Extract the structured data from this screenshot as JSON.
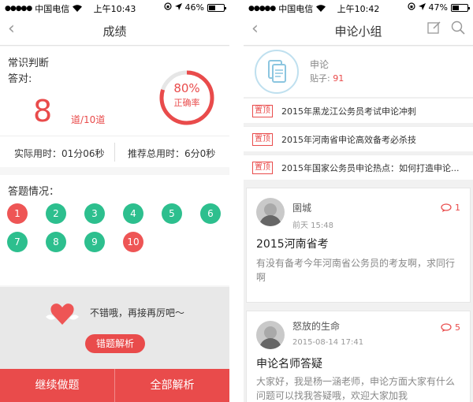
{
  "left": {
    "status": {
      "carrier": "中国电信",
      "time": "上午10:43",
      "battery": "46%",
      "battery_level": 0.46
    },
    "nav_title": "成绩",
    "category": "常识判断",
    "correct_label": "答对:",
    "correct_count": "8",
    "total_label": "道/10道",
    "accuracy": "80%",
    "accuracy_label": "正确率",
    "accuracy_fraction": 0.8,
    "actual_time": "实际用时：01分06秒",
    "recommended_time": "推荐总用时：6分0秒",
    "answers_label": "答题情况：",
    "answers": [
      {
        "n": "1",
        "status": "wrong"
      },
      {
        "n": "2",
        "status": "right"
      },
      {
        "n": "3",
        "status": "right"
      },
      {
        "n": "4",
        "status": "right"
      },
      {
        "n": "5",
        "status": "right"
      },
      {
        "n": "6",
        "status": "right"
      },
      {
        "n": "7",
        "status": "right"
      },
      {
        "n": "8",
        "status": "right"
      },
      {
        "n": "9",
        "status": "right"
      },
      {
        "n": "10",
        "status": "wrong"
      }
    ],
    "feedback": "不错哦，再接再厉吧～",
    "mistakes_button": "错题解析",
    "continue_button": "继续做题",
    "all_analysis_button": "全部解析"
  },
  "right": {
    "status": {
      "carrier": "中国电信",
      "time": "上午10:42",
      "battery": "47%",
      "battery_level": 0.47
    },
    "nav_title": "申论小组",
    "group_name": "申论",
    "posts_label": "贴子:",
    "posts_count": "91",
    "pinned_tag": "置顶",
    "pinned": [
      "2015年黑龙江公务员考试申论冲刺",
      "2015年河南省申论高效备考必杀技",
      "2015年国家公务员申论热点：如何打造申论..."
    ],
    "posts": [
      {
        "author": "圉城",
        "time": "前天 15:48",
        "comments": "1",
        "title": "2015河南省考",
        "body": "有没有备考今年河南省公务员的考友啊，求同行啊"
      },
      {
        "author": "怒放的生命",
        "time": "2015-08-14 17:41",
        "comments": "5",
        "title": "申论名师答疑",
        "body": "大家好，我是杨一涵老师，申论方面大家有什么问题可以找我答疑哦，欢迎大家加我"
      }
    ]
  },
  "colors": {
    "accent": "#e94b4b",
    "right_answer": "#2dbf8e",
    "wrong_answer": "#ee5555"
  }
}
